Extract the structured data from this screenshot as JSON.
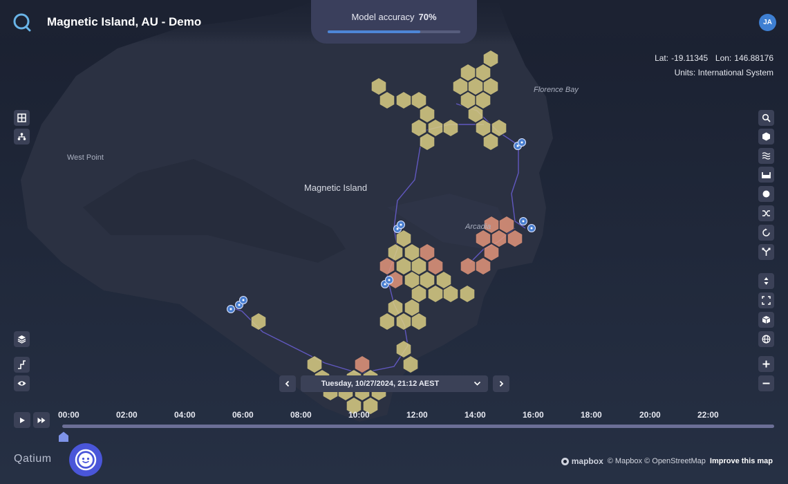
{
  "app": {
    "title": "Magnetic Island, AU - Demo",
    "brand": "Qatium"
  },
  "model": {
    "label": "Model accuracy",
    "value": "70%",
    "fraction": 0.7
  },
  "user": {
    "initials": "JA"
  },
  "position": {
    "lat_label": "Lat:",
    "lat": "-19.11345",
    "lon_label": "Lon:",
    "lon": "146.88176",
    "units": "Units: International System"
  },
  "places": {
    "florence_bay": "Florence Bay",
    "west_point": "West Point",
    "magnetic_island": "Magnetic Island",
    "arcadia": "Arcadia"
  },
  "date": {
    "text": "Tuesday, 10/27/2024, 21:12 AEST"
  },
  "timeline": {
    "ticks": [
      "00:00",
      "02:00",
      "04:00",
      "06:00",
      "08:00",
      "10:00",
      "12:00",
      "14:00",
      "16:00",
      "18:00",
      "20:00",
      "22:00"
    ]
  },
  "attribution": {
    "mapbox": "mapbox",
    "text": "© Mapbox © OpenStreetMap",
    "improve": "Improve this map"
  },
  "colors": {
    "accent": "#4d86d6",
    "hex_normal": "#d9cc82",
    "hex_alert": "#e3957a",
    "sensor": "#4a7fd0",
    "assistant": "#4a56d9"
  },
  "icons": {
    "left_top": [
      "grid-icon",
      "network-icon"
    ],
    "left_bottom": [
      "layers-icon",
      "graph-icon",
      "eye-icon"
    ],
    "right_tools": [
      "search-icon",
      "hexagon-icon",
      "waves-icon",
      "tank-icon",
      "circle-icon",
      "shuffle-icon",
      "cycle-icon",
      "fork-icon"
    ],
    "right_view": [
      "pitch-icon",
      "fullscreen-icon",
      "cube-icon",
      "globe-icon",
      "zoom-in-icon",
      "zoom-out-icon"
    ]
  }
}
